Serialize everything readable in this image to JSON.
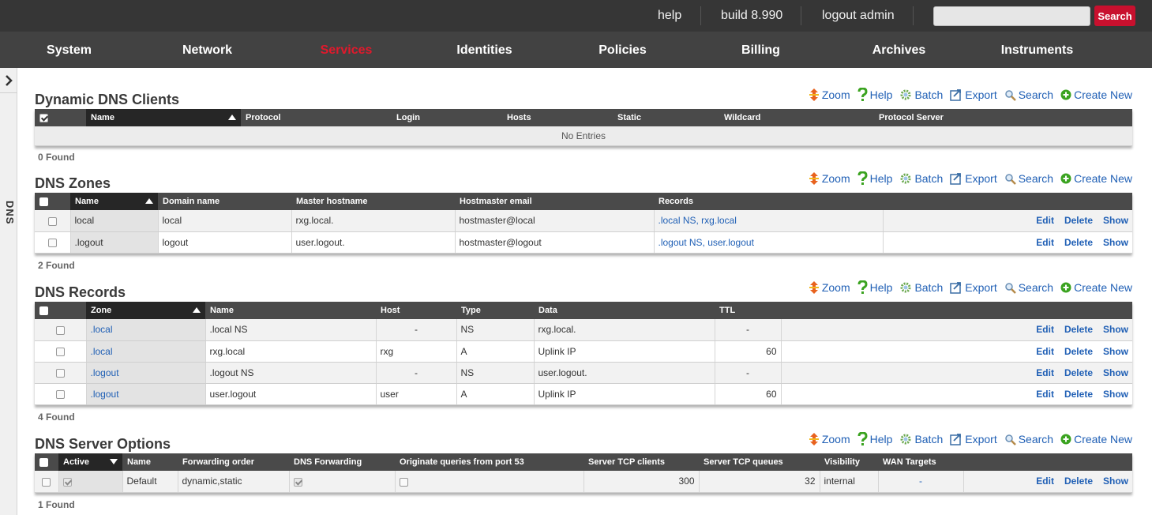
{
  "topbar": {
    "help": "help",
    "build": "build 8.990",
    "logout": "logout admin",
    "search_button": "Search",
    "search_value": ""
  },
  "nav": [
    "System",
    "Network",
    "Services",
    "Identities",
    "Policies",
    "Billing",
    "Archives",
    "Instruments"
  ],
  "nav_active": "Services",
  "sidebar": {
    "label": "DNS"
  },
  "toolbar": {
    "zoom": "Zoom",
    "help": "Help",
    "batch": "Batch",
    "export": "Export",
    "search": "Search",
    "create": "Create New"
  },
  "actions": {
    "edit": "Edit",
    "delete": "Delete",
    "show": "Show"
  },
  "colors": {
    "topbar": "#363636",
    "nav": "#424242",
    "active_nav": "#e0192c",
    "link": "#1f5fb5",
    "search_button": "#c8102e"
  },
  "icons": {
    "sidebar_toggle": "chevron-right-icon",
    "zoom": "arrows-vertical-icon",
    "help": "question-mark-icon",
    "batch": "gear-icon",
    "export": "export-icon",
    "search": "magnifier-icon",
    "create": "plus-circle-icon"
  },
  "ddns": {
    "title": "Dynamic DNS Clients",
    "headers": [
      "Name",
      "Protocol",
      "Login",
      "Hosts",
      "Static",
      "Wildcard",
      "Protocol Server"
    ],
    "empty": "No Entries",
    "found": "0 Found"
  },
  "zones": {
    "title": "DNS Zones",
    "headers": [
      "Name",
      "Domain name",
      "Master hostname",
      "Hostmaster email",
      "Records"
    ],
    "rows": [
      [
        "local",
        "local",
        "rxg.local.",
        "hostmaster@local",
        ".local NS, rxg.local"
      ],
      [
        ".logout",
        "logout",
        "user.logout.",
        "hostmaster@logout",
        ".logout NS, user.logout"
      ]
    ],
    "found": "2 Found"
  },
  "records": {
    "title": "DNS Records",
    "headers": [
      "Zone",
      "Name",
      "Host",
      "Type",
      "Data",
      "TTL"
    ],
    "rows": [
      [
        ".local",
        ".local NS",
        "-",
        "NS",
        "rxg.local.",
        "-"
      ],
      [
        ".local",
        "rxg.local",
        "rxg",
        "A",
        "Uplink IP",
        "60"
      ],
      [
        ".logout",
        ".logout NS",
        "-",
        "NS",
        "user.logout.",
        "-"
      ],
      [
        ".logout",
        "user.logout",
        "user",
        "A",
        "Uplink IP",
        "60"
      ]
    ],
    "found": "4 Found"
  },
  "options": {
    "title": "DNS Server Options",
    "headers": [
      "Active",
      "Name",
      "Forwarding order",
      "DNS Forwarding",
      "Originate queries from port 53",
      "Server TCP clients",
      "Server TCP queues",
      "Visibility",
      "WAN Targets"
    ],
    "rows": [
      {
        "active": true,
        "name": "Default",
        "forwarding_order": "dynamic,static",
        "dns_forwarding": true,
        "originate_port53": false,
        "tcp_clients": "300",
        "tcp_queues": "32",
        "visibility": "internal",
        "wan_targets": "-"
      }
    ],
    "found": "1 Found"
  }
}
